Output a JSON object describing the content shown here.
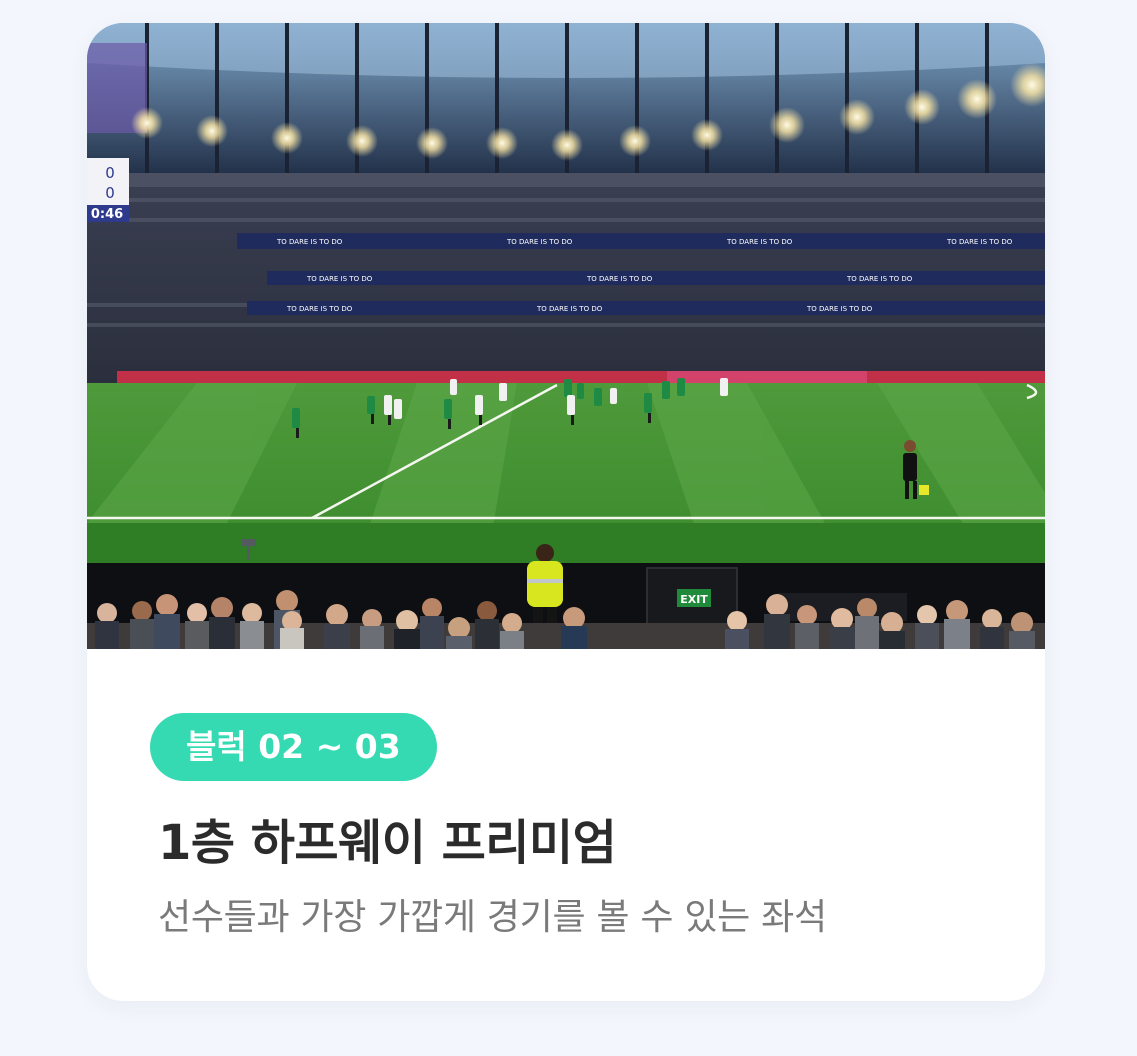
{
  "seat_card": {
    "photo_alt": "Stadium view from seat",
    "scoreboard": {
      "home": "0",
      "away": "0",
      "clock": "0:46"
    },
    "ad_board_text": "TO DARE IS TO DO",
    "exit_sign": "EXIT",
    "badge": "블럭 02 ~ 03",
    "title": "1층 하프웨이 프리미엄",
    "subtitle": "선수들과 가장 가깝게 경기를 볼 수 있는 좌석"
  },
  "colors": {
    "page_background": "#f3f6fc",
    "card_background": "#ffffff",
    "badge_background": "#35d9b2",
    "title_text": "#2b2b2b",
    "subtitle_text": "#7a7a7a"
  }
}
